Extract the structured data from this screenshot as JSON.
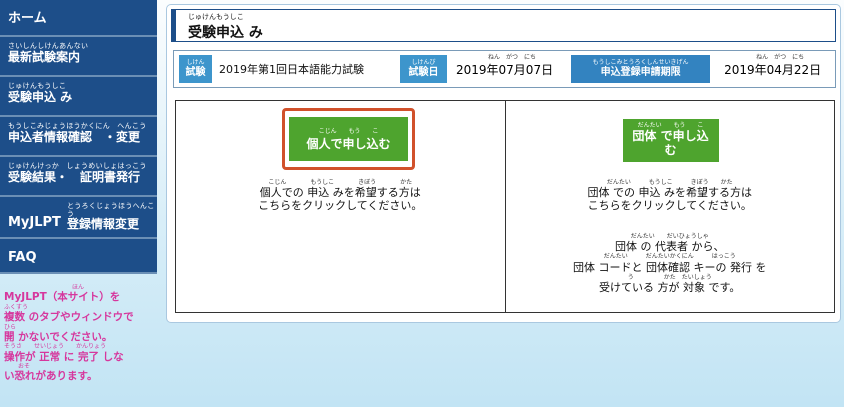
{
  "sidebar": {
    "items": [
      {
        "label": "ホーム"
      },
      {
        "furigana": "さいしんしけんあんない",
        "label": "最新試験案内"
      },
      {
        "furigana": "じゅけんもうしこ",
        "label": "受験申込 み"
      },
      {
        "furigana": "もうしこみじょうほうかくにん　へんこう",
        "label": "申込者情報確認　・変更"
      },
      {
        "furigana": "じゅけんけっか　しょうめいしょはっこう",
        "label": "受験結果・　証明書発行"
      },
      {
        "label": "MyJLPT",
        "furigana": "とうろくじょうほうへんこう",
        "sub": "登録情報変更"
      },
      {
        "label": "FAQ"
      }
    ]
  },
  "notice": {
    "line1_furi": "ほん",
    "line1": "MyJLPT（本サイト）を",
    "line2_furi": "ふくすう",
    "line2": "複数 のタブやウィンドウで",
    "line3_furi": "ひら",
    "line3": "開 かないでください。",
    "line4_furi": "そうさ　　せいじょう　　かんりょう",
    "line4": "操作が 正常 に 完了 しな",
    "line5_furi": "おそ",
    "line5": "い恐れがあります。"
  },
  "page": {
    "title_furigana": "じゅけんもうしこ",
    "title": "受験申込 み"
  },
  "info": {
    "exam_tag_furi": "しけん",
    "exam_tag": "試験",
    "exam_name": "2019年第1回日本語能力試験",
    "date_tag_furi": "しけんび",
    "date_tag": "試験日",
    "date_furi": "ねん　がつ　にち",
    "exam_date": "2019年07月07日",
    "deadline_tag_furi": "もうしこみとうろくしんせいきげん",
    "deadline_tag": "申込登録申請期限",
    "deadline_furi": "ねん　がつ　にち",
    "deadline": "2019年04月22日"
  },
  "personal": {
    "button_furi": "こじん　　もう　　こ",
    "button": "個人で申し込む",
    "desc_furi": "こじん　　　　もうしこ　　　　きぼう　　　　かた",
    "desc1": "個人での 申込 みを希望する方は",
    "desc2": "こちらをクリックしてください。"
  },
  "group": {
    "button_furi": "だんたい　　もう　　こ",
    "button1": "団体 で申し込",
    "button2": "む",
    "desc_furi": "だんたい　　　もうしこ　　　きぼう　　かた",
    "desc1": "団体 での 申込 みを希望する方は",
    "desc2": "こちらをクリックしてください。",
    "note_furi1": "だんたい　　だいひょうしゃ",
    "note1": "団体 の 代表者 から、",
    "note_furi2": "だんたい　　　だんたいかくにん　　　はっこう",
    "note2": "団体 コードと 団体確認 キーの 発行 を",
    "note_furi3": "う　　　　　かた　たいしょう",
    "note3": "受けている 方が 対象 です。"
  },
  "colors": {
    "nav": "#1d4e89",
    "accent_tag": "#3d95cc",
    "button": "#4ea42e",
    "highlight": "#d1512b",
    "notice": "#d6379d"
  }
}
